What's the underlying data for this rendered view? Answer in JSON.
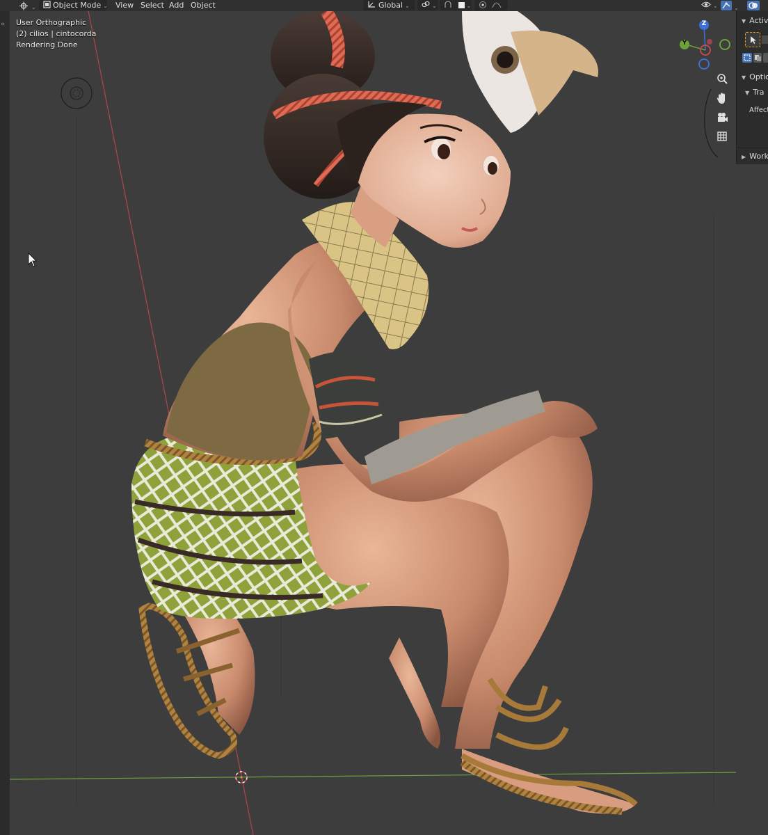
{
  "header": {
    "mode_label": "Object Mode",
    "menu": [
      "View",
      "Select",
      "Add",
      "Object"
    ],
    "transform_orientation": "Global"
  },
  "overlay": {
    "view_name": "User Orthographic",
    "collection_info": "(2) cilios | cintocorda",
    "status": "Rendering Done"
  },
  "sidebar": {
    "active_tool_label": "Activ",
    "options_label": "Optio",
    "transform_label": "Tra",
    "affect_label": "Affect",
    "workspace_label": "Work"
  },
  "gizmo": {
    "axis_z": "Z",
    "axis_y": "Y"
  },
  "colors": {
    "x_axis": "#c04a52",
    "y_axis": "#6ea03c",
    "z_axis": "#3d6fd6",
    "viewport_bg": "#3d3d3d",
    "accent": "#4772b3"
  },
  "icons": [
    "editor-type-icon",
    "object-mode-icon",
    "transform-orientation-icon",
    "snap-icon",
    "proportional-edit-icon",
    "visibility-icon",
    "gizmo-icon",
    "overlay-icon",
    "zoom-icon",
    "hand-pan-icon",
    "camera-icon",
    "grid-icon",
    "cursor-icon",
    "3d-cursor-icon",
    "light-probe-icon"
  ]
}
